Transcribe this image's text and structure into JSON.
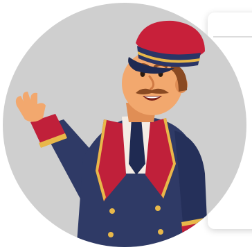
{
  "illustration": {
    "subject": "doorman-mascot",
    "palette": {
      "background_circle": "#cfcfcf",
      "coat": "#2f3a66",
      "coat_shadow": "#25305a",
      "trim_red": "#c0203a",
      "trim_gold": "#e8b84a",
      "cap_red": "#c8203a",
      "cap_band": "#2a3566",
      "skin": "#f2a86e",
      "skin_shadow": "#e08e55",
      "hair": "#8a4a22",
      "shirt": "#f4ece4",
      "tie": "#1f2a52",
      "buttons": "#e8b84a"
    }
  },
  "side_card": {
    "background": "#ffffff"
  }
}
